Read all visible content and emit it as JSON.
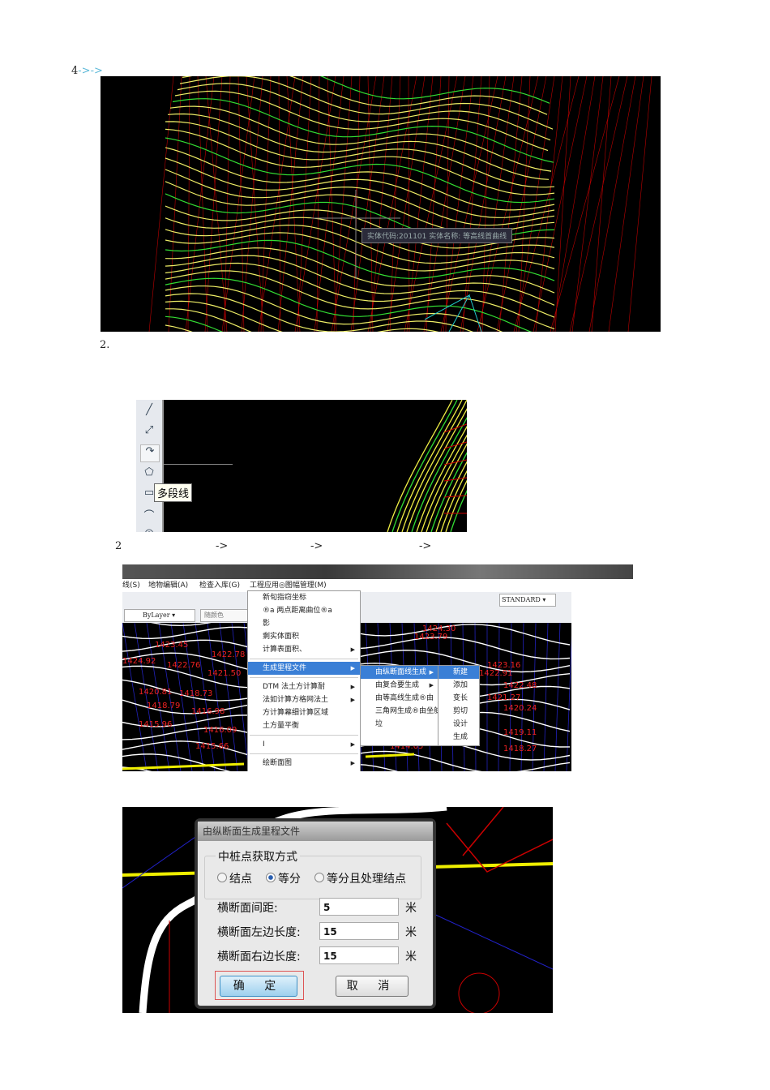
{
  "heading1": {
    "num": "4",
    "arrows": "->->"
  },
  "figure1": {
    "tooltip": "实体代码:201101 实体名称: 等高线首曲线"
  },
  "step2_label": "2.",
  "figure2": {
    "tooltip": "多段线"
  },
  "step_line": {
    "num": "2",
    "arrow1": "->",
    "arrow2": "->",
    "arrow3": "->"
  },
  "figure3": {
    "menubar": [
      "线(S)",
      "地物编辑(A)",
      "检查入库(G)",
      "工程应用◎图幅管理(M)"
    ],
    "linetype": "ByLayer",
    "color": "随颜色",
    "textstyle": "STANDARD",
    "menu_items": [
      "新旬指窃坐标",
      "®a 两点距离曲位®a",
      "影",
      "剩实体面积",
      "计算表面积、",
      "生成里程文件",
      "DTM 法土方计算耐",
      "法如计算方格网法土",
      "方计算幕细计算区域",
      "土方量平衡",
      "I",
      "绘断面图"
    ],
    "submenu_items": [
      "由纵断面线生成",
      "由复合要生成",
      "由等高线生成®由",
      "三角网生成®由坐舷件",
      "垃"
    ],
    "subsub_items": [
      "新建",
      "添加",
      "变长",
      "剪切",
      "设计",
      "生成"
    ],
    "labels": [
      "1423.45",
      "1422.78",
      "1424.92",
      "1422.76",
      "1421.50",
      "1420.81",
      "1418.73",
      "1418.79",
      "1416.98",
      "1415.96",
      "1416.09",
      "1415.66",
      "1424.30",
      "1423.79",
      "1423.16",
      "1422.91",
      "1422.48",
      "1421.27",
      "1420.24",
      "1419.11",
      "1418.27",
      "1414.65"
    ]
  },
  "figure4": {
    "dialog_title": "由纵断面生成里程文件",
    "group_title": "中桩点获取方式",
    "radios": [
      {
        "label": "结点",
        "checked": false
      },
      {
        "label": "等分",
        "checked": true
      },
      {
        "label": "等分且处理结点",
        "checked": false
      }
    ],
    "fields": [
      {
        "label": "横断面间距:",
        "value": "5",
        "unit": "米"
      },
      {
        "label": "横断面左边长度:",
        "value": "15",
        "unit": "米"
      },
      {
        "label": "横断面右边长度:",
        "value": "15",
        "unit": "米"
      }
    ],
    "ok": "确 定",
    "cancel": "取 消"
  }
}
